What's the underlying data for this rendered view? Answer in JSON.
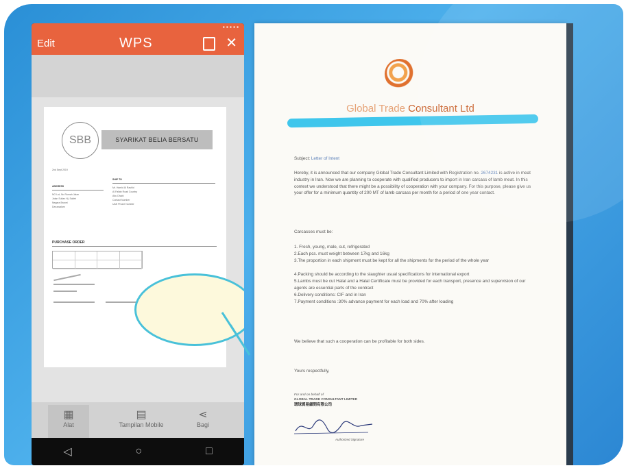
{
  "phone": {
    "app_bar": {
      "edit_label": "Edit",
      "logo_text": "WPS",
      "close_glyph": "✕"
    },
    "document": {
      "logo_initials": "SBB",
      "company_name": "SYARIKAT BELIA BERSATU",
      "date_text": "2nd Sept 2019",
      "address_label": "ADDRESS",
      "ship_to_label": "SHIP TO",
      "address_lines": [
        "NO Lot, No Rumah Jalan",
        "Jalan Sultan Hj. Salleh",
        "Negara Brunei",
        "Darussalam"
      ],
      "ship_to_lines": [
        "Mr. Hamid Al Rashid",
        "Al Fallah Road Country",
        "Abu Dhabi",
        "Contact Number",
        "UAE Phone Number"
      ],
      "po_title": "PURCHASE ORDER"
    },
    "bottom_nav": [
      {
        "label": "Alat",
        "icon": "grid-icon"
      },
      {
        "label": "Tampilan Mobile",
        "icon": "mobile-view-icon"
      },
      {
        "label": "Bagi",
        "icon": "share-icon"
      }
    ],
    "android_nav": {
      "back": "◁",
      "home": "○",
      "recents": "□"
    }
  },
  "letter": {
    "company_prefix": "Global Trade ",
    "company_suffix": "Consultant Ltd",
    "subject_label": "Subject:",
    "subject_value": "Letter of Intent",
    "intro_pre": "Hereby, it is announced that our company Global Trade Consultant Limited with Registration no.",
    "registration_no": "2674231",
    "intro_post": "is active in meat industry in Iran. Now we are planning to cooperate with qualified producers to import in Iran carcass of lamb meat. In this context we understood that there might be a possibility of cooperation with your company. For this purpose, please give us your offer for a minimum quantity of 200 MT of lamb carcass per month for a period of one year contact.",
    "carcasses_heading": "Carcasses must be:",
    "requirements": [
      "1. Fresh, young, male, cut, refrigerated",
      "2.Each pcs. must weight between 17kg and 16kg",
      "3.The proportion in each shipment must be kept for all the shipments for the period of the whole year",
      "4.Packing should be according to the slaughter usual specifications for international export",
      "5.Lambs must be cut Halal and a Halal Certificate must be provided for each transport, presence and supervision of our agents are essential parts of the contract",
      "6.Delivery conditions: CIF and in Iran",
      "7.Payment conditions :30% advance payment for each load and 70% after loading"
    ],
    "closing_text": "We believe that such a cooperation can be profitable for both sides.",
    "sign_off": "Yours respectfully,",
    "stamp_line1": "For and on behalf of",
    "stamp_line2": "GLOBAL TRADE CONSULTANT LIMITED",
    "stamp_line3": "環球貿易顧問有限公司",
    "stamp_line4": "Authorized Signature"
  },
  "colors": {
    "accent": "#e8633e",
    "frame": "#3a9ee0",
    "bubble_border": "#49c1d9",
    "redaction": "#3fc6ec"
  }
}
